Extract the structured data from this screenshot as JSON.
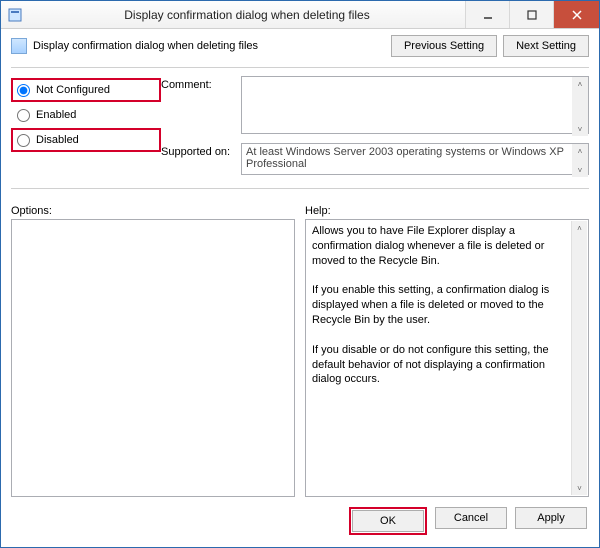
{
  "titlebar": {
    "title": "Display confirmation dialog when deleting files"
  },
  "header": {
    "label": "Display confirmation dialog when deleting files"
  },
  "nav": {
    "previous": "Previous Setting",
    "next": "Next Setting"
  },
  "radios": {
    "not_configured": "Not Configured",
    "enabled": "Enabled",
    "disabled": "Disabled"
  },
  "fields": {
    "comment_label": "Comment:",
    "comment_value": "",
    "supported_label": "Supported on:",
    "supported_value": "At least Windows Server 2003 operating systems or Windows XP Professional"
  },
  "lower": {
    "options_label": "Options:",
    "help_label": "Help:",
    "help_text": "Allows you to have File Explorer display a confirmation dialog whenever a file is deleted or moved to the Recycle Bin.\n\nIf you enable this setting, a confirmation dialog is displayed when a file is deleted or moved to the Recycle Bin by the user.\n\nIf you disable or do not configure this setting, the default behavior of not displaying a confirmation dialog occurs."
  },
  "footer": {
    "ok": "OK",
    "cancel": "Cancel",
    "apply": "Apply"
  }
}
